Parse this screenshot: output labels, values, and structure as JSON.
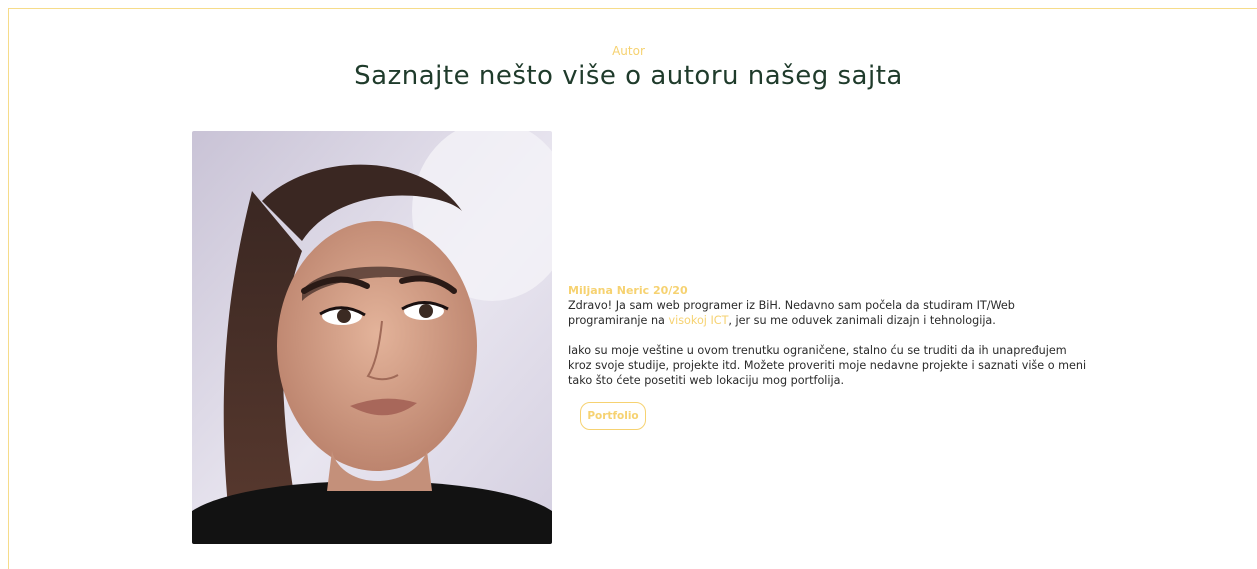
{
  "section": {
    "eyebrow": "Autor",
    "title": "Saznajte nešto više o autoru našeg sajta"
  },
  "author": {
    "name": "Miljana Neric 20/20",
    "intro_before_link": "Zdravo! Ja sam web programer iz BiH. Nedavno sam počela da studiram IT/Web programiranje na ",
    "link_label": "visokoj ICT",
    "intro_after_link": ", jer su me oduvek zanimali dizajn i tehnologija.",
    "paragraph2": "Iako su moje veštine u ovom trenutku ograničene, stalno ću se truditi da ih unapređujem kroz svoje studije, projekte itd. Možete proveriti moje nedavne projekte i saznati više o meni tako što ćete posetiti web lokaciju mog portfolija.",
    "portfolio_button": "Portfolio"
  },
  "colors": {
    "accent": "#f6d271",
    "heading": "#1f3b2b",
    "text": "#2a2a2a"
  }
}
